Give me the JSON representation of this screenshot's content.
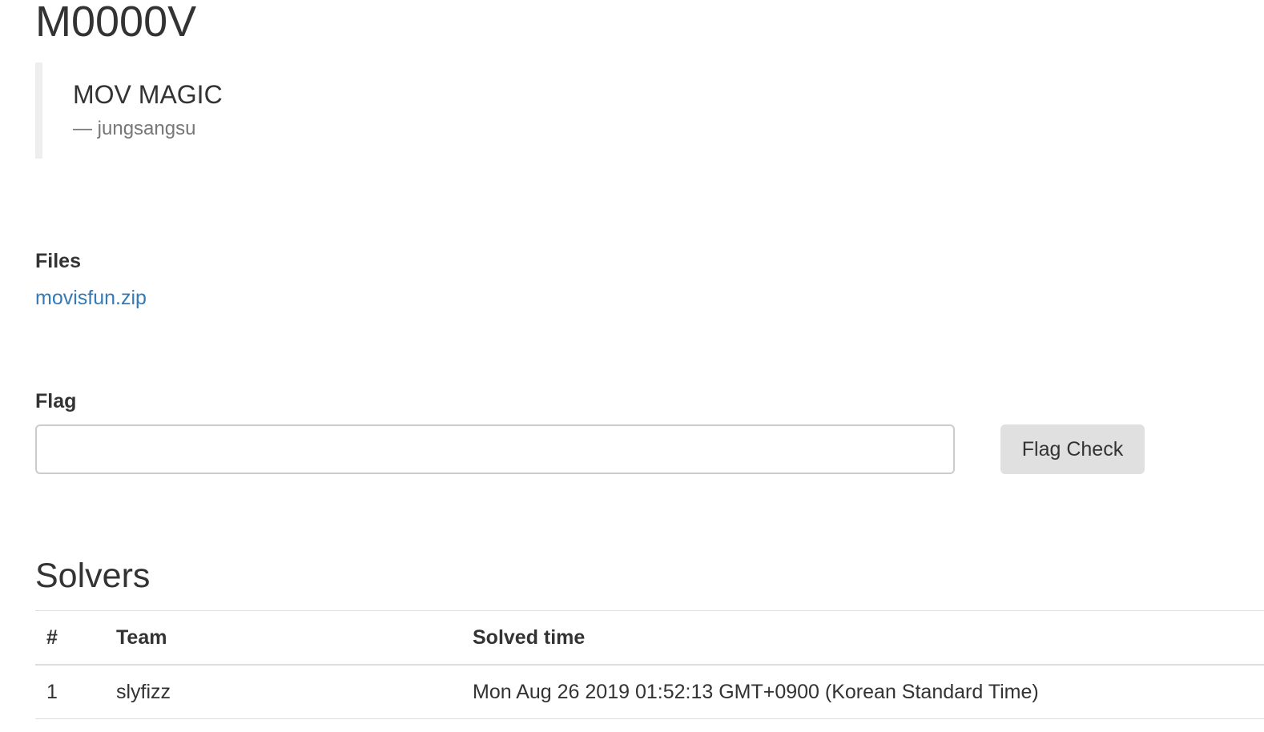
{
  "challenge": {
    "title": "M0000V",
    "description": "MOV MAGIC",
    "author": "— jungsangsu"
  },
  "files": {
    "label": "Files",
    "items": [
      {
        "name": "movisfun.zip"
      }
    ]
  },
  "flag": {
    "label": "Flag",
    "input_value": "",
    "placeholder": "",
    "button_label": "Flag Check"
  },
  "solvers": {
    "title": "Solvers",
    "columns": [
      "#",
      "Team",
      "Solved time"
    ],
    "rows": [
      [
        "1",
        "slyfizz",
        "Mon Aug 26 2019 01:52:13 GMT+0900 (Korean Standard Time)"
      ]
    ]
  },
  "colors": {
    "link": "#337ab7",
    "text": "#333333",
    "muted": "#777777",
    "button_bg": "#e0e0e0"
  }
}
